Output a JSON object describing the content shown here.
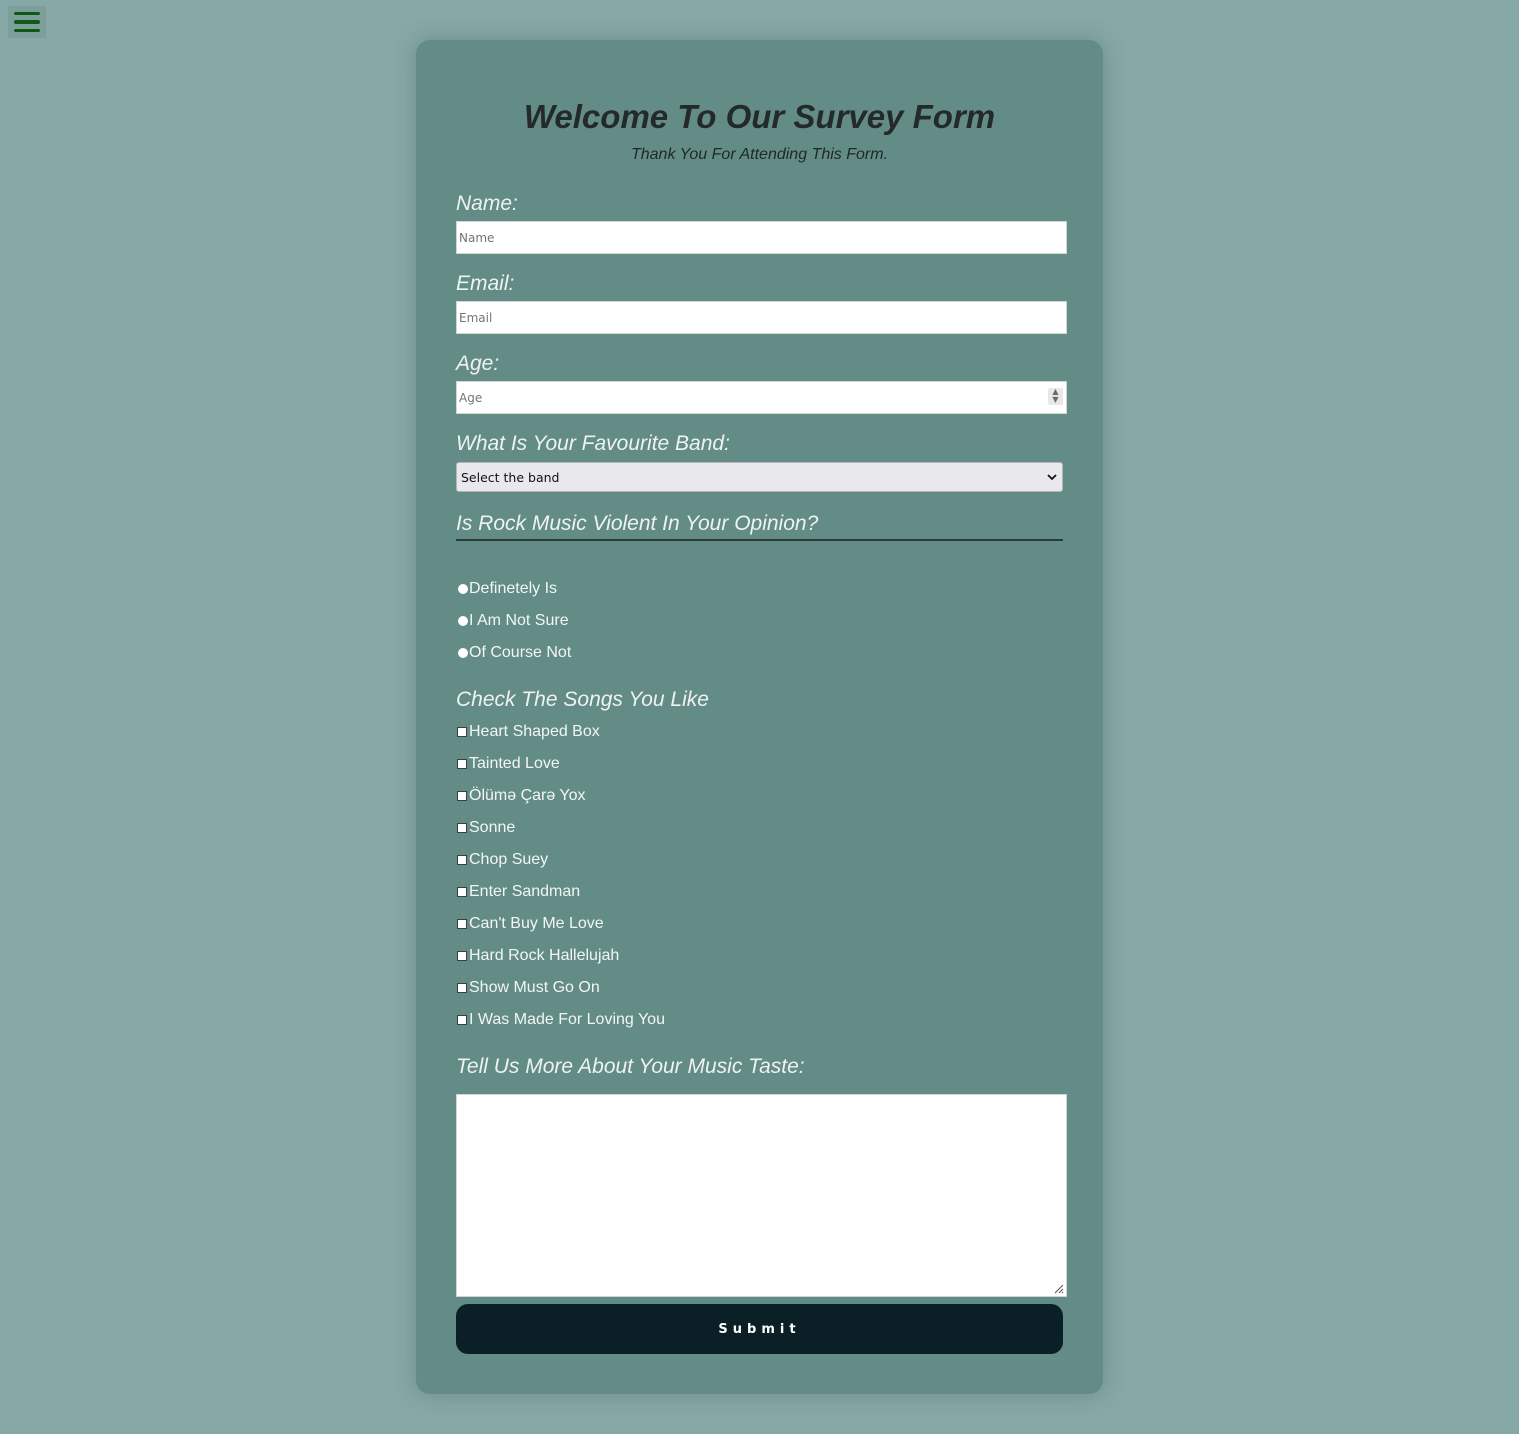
{
  "menu": {
    "icon": "hamburger-menu-icon"
  },
  "header": {
    "title": "Welcome To Our Survey Form",
    "subtitle": "Thank You For Attending This Form."
  },
  "fields": {
    "name": {
      "label": "Name:",
      "placeholder": "Name",
      "value": ""
    },
    "email": {
      "label": "Email:",
      "placeholder": "Email",
      "value": ""
    },
    "age": {
      "label": "Age:",
      "placeholder": "Age",
      "value": ""
    },
    "band": {
      "label": "What Is Your Favourite Band:",
      "selected": "Select the band"
    }
  },
  "violence_question": {
    "label": "Is Rock Music Violent In Your Opinion?",
    "options": [
      "Definetely Is",
      "I Am Not Sure",
      "Of Course Not"
    ]
  },
  "songs": {
    "label": "Check The Songs You Like",
    "options": [
      "Heart Shaped Box",
      "Tainted Love",
      "Ölümə Çarə Yox",
      "Sonne",
      "Chop Suey",
      "Enter Sandman",
      "Can't Buy Me Love",
      "Hard Rock Hallelujah",
      "Show Must Go On",
      "I Was Made For Loving You"
    ]
  },
  "comments": {
    "label": "Tell Us More About Your Music Taste:",
    "value": ""
  },
  "submit": {
    "label": "Submit"
  },
  "colors": {
    "page_bg": "#86a8a6",
    "card_bg": "#638c86",
    "button_bg": "#0b1f26",
    "menu_icon": "#0f5a15"
  }
}
